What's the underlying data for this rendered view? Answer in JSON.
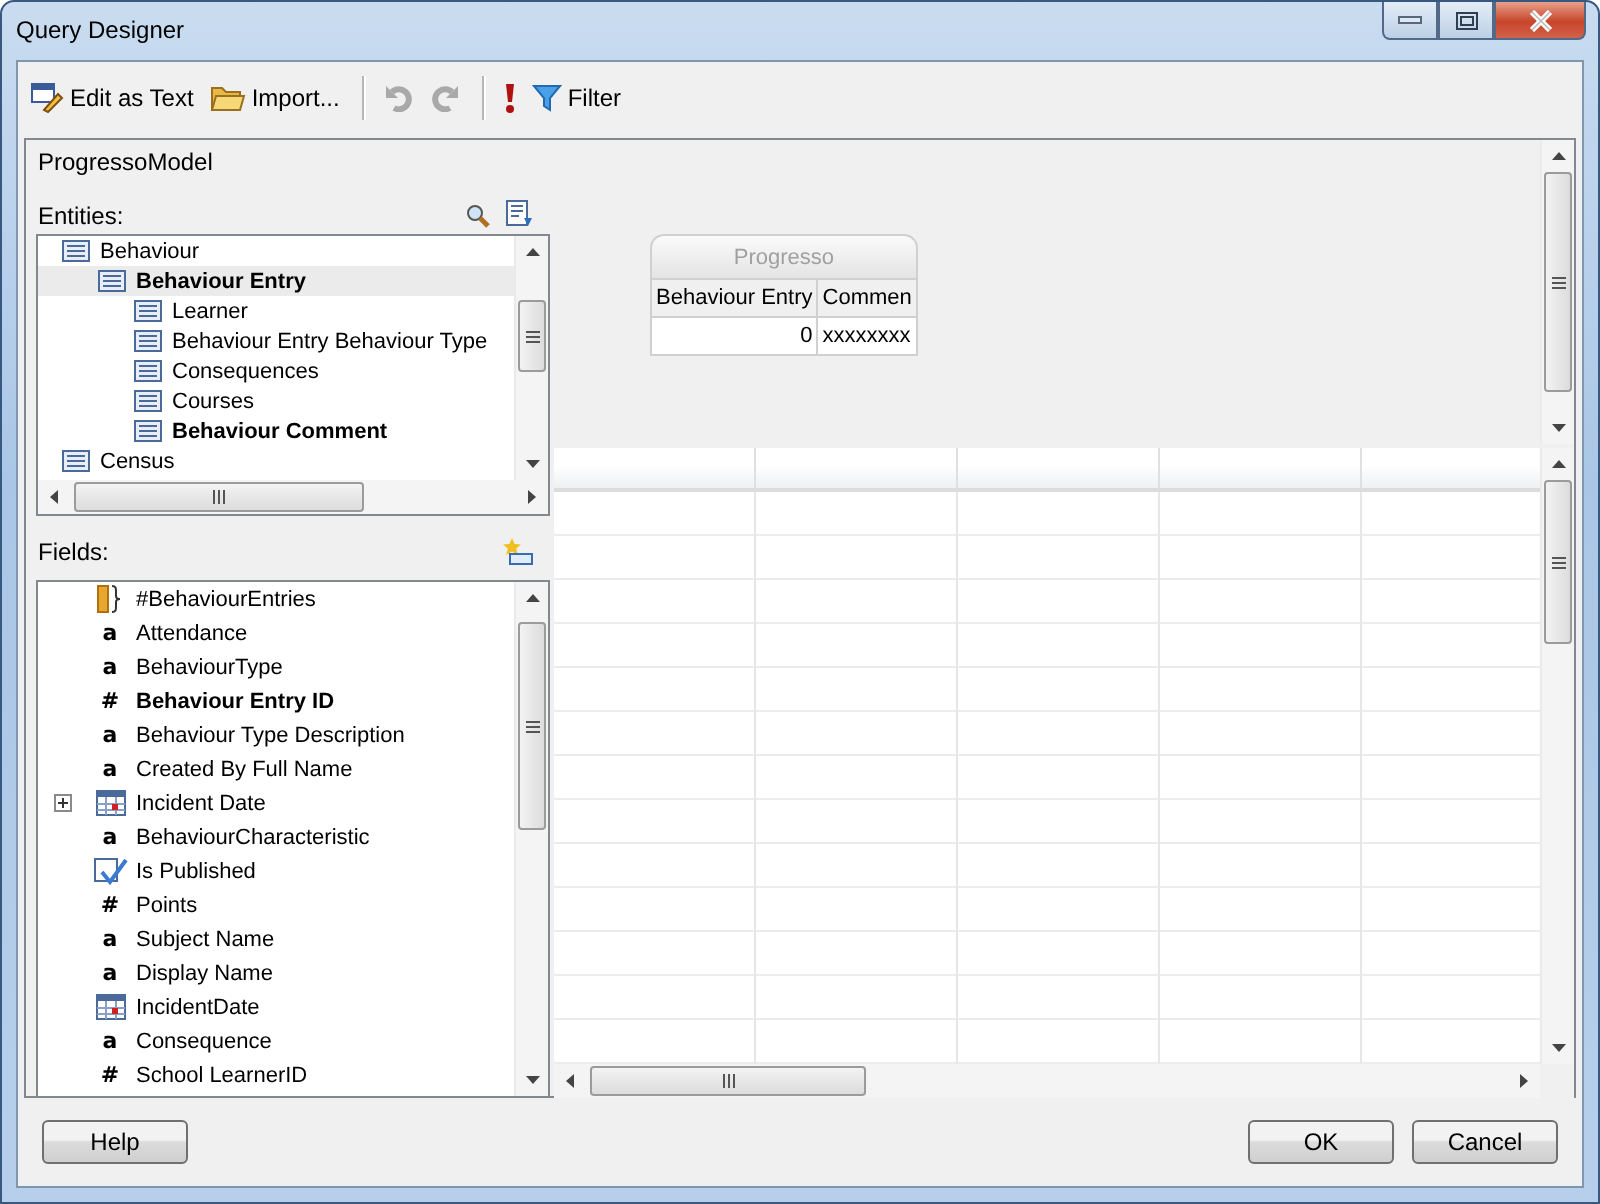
{
  "window": {
    "title": "Query Designer"
  },
  "toolbar": [
    [
      {
        "kind": "edit",
        "label": "Edit as Text",
        "disabled": false
      },
      {
        "kind": "import",
        "label": "Import...",
        "disabled": false
      }
    ],
    [
      {
        "kind": "undo",
        "disabled": true
      },
      {
        "kind": "redo",
        "disabled": true
      }
    ],
    [
      {
        "kind": "run",
        "disabled": false
      },
      {
        "kind": "filter",
        "label": "Filter",
        "disabled": false
      }
    ]
  ],
  "model_name": "ProgressoModel",
  "entities": {
    "label": "Entities:",
    "items": [
      {
        "label": "Behaviour",
        "bold": false,
        "selected": false,
        "children": [
          {
            "label": "Behaviour Entry",
            "bold": true,
            "selected": true,
            "children": [
              {
                "label": "Learner",
                "bold": false,
                "selected": false
              },
              {
                "label": "Behaviour Entry Behaviour Type",
                "bold": false,
                "selected": false
              },
              {
                "label": "Consequences",
                "bold": false,
                "selected": false
              },
              {
                "label": "Courses",
                "bold": false,
                "selected": false
              },
              {
                "label": "Behaviour Comment",
                "bold": true,
                "selected": false
              }
            ]
          }
        ]
      },
      {
        "label": "Census",
        "bold": false,
        "selected": false
      }
    ]
  },
  "fields": {
    "label": "Fields:",
    "items": [
      {
        "kind": "aggregate",
        "label": "#BehaviourEntries",
        "bold": false,
        "expandable": false
      },
      {
        "kind": "text",
        "glyph": "a",
        "label": "Attendance",
        "bold": false,
        "expandable": false
      },
      {
        "kind": "text",
        "glyph": "a",
        "label": "BehaviourType",
        "bold": false,
        "expandable": false
      },
      {
        "kind": "number",
        "glyph": "#",
        "label": "Behaviour Entry ID",
        "bold": true,
        "expandable": false
      },
      {
        "kind": "text",
        "glyph": "a",
        "label": "Behaviour Type Description",
        "bold": false,
        "expandable": false
      },
      {
        "kind": "text",
        "glyph": "a",
        "label": "Created By Full Name",
        "bold": false,
        "expandable": false
      },
      {
        "kind": "date",
        "label": "Incident Date",
        "bold": false,
        "expandable": true
      },
      {
        "kind": "text",
        "glyph": "a",
        "label": "BehaviourCharacteristic",
        "bold": false,
        "expandable": false
      },
      {
        "kind": "boolean",
        "label": "Is Published",
        "bold": false,
        "expandable": false
      },
      {
        "kind": "number",
        "glyph": "#",
        "label": "Points",
        "bold": false,
        "expandable": false
      },
      {
        "kind": "text",
        "glyph": "a",
        "label": "Subject Name",
        "bold": false,
        "expandable": false
      },
      {
        "kind": "text",
        "glyph": "a",
        "label": "Display Name",
        "bold": false,
        "expandable": false
      },
      {
        "kind": "date",
        "label": "IncidentDate",
        "bold": false,
        "expandable": false
      },
      {
        "kind": "text",
        "glyph": "a",
        "label": "Consequence",
        "bold": false,
        "expandable": false
      },
      {
        "kind": "number",
        "glyph": "#",
        "label": "School LearnerID",
        "bold": false,
        "expandable": false
      }
    ]
  },
  "diagram": {
    "tables": [
      {
        "title": "Progresso",
        "columns": [
          "Behaviour Entry",
          "Commen"
        ],
        "rows": [
          [
            "0",
            "xxxxxxxx"
          ]
        ]
      }
    ]
  },
  "footer": {
    "left": [
      "Help"
    ],
    "right": [
      "OK",
      "Cancel"
    ]
  }
}
